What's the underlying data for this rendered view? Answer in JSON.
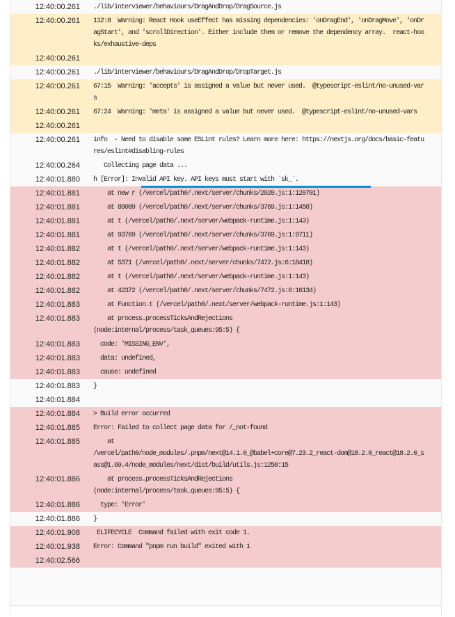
{
  "log": [
    {
      "ts": "12:40:00.261",
      "type": "normal",
      "msg": "./lib/interviewer/behaviours/DragAndDrop/DragSource.js"
    },
    {
      "ts": "12:40:00.261",
      "type": "warn",
      "msg": "112:8  Warning: React Hook useEffect has missing dependencies: 'onDragEnd', 'onDragMove', 'onDragStart', and 'scrollDirection'. Either include them or remove the dependency array.  react-hooks/exhaustive-deps"
    },
    {
      "ts": "12:40:00.261",
      "type": "warn",
      "msg": ""
    },
    {
      "ts": "12:40:00.261",
      "type": "normal",
      "msg": "./lib/interviewer/behaviours/DragAndDrop/DropTarget.js"
    },
    {
      "ts": "12:40:00.261",
      "type": "warn",
      "msg": "67:15  Warning: 'accepts' is assigned a value but never used.  @typescript-eslint/no-unused-vars"
    },
    {
      "ts": "12:40:00.261",
      "type": "warn",
      "msg": "67:24  Warning: 'meta' is assigned a value but never used.  @typescript-eslint/no-unused-vars"
    },
    {
      "ts": "12:40:00.261",
      "type": "warn",
      "msg": ""
    },
    {
      "ts": "12:40:00.261",
      "type": "normal",
      "msg": "info  - Need to disable some ESLint rules? Learn more here: https://nextjs.org/docs/basic-features/eslint#disabling-rules"
    },
    {
      "ts": "12:40:00.264",
      "type": "normal",
      "msg": "   Collecting page data ..."
    },
    {
      "ts": "12:40:01.880",
      "type": "normal",
      "msg": "h [Error]: Invalid API key. API keys must start with `sk_`.",
      "highlight": true
    },
    {
      "ts": "12:40:01.881",
      "type": "error",
      "msg": "    at new r (/vercel/path0/.next/server/chunks/2920.js:1:120701)"
    },
    {
      "ts": "12:40:01.881",
      "type": "error",
      "msg": "    at 89089 (/vercel/path0/.next/server/chunks/3769.js:1:1458)"
    },
    {
      "ts": "12:40:01.881",
      "type": "error",
      "msg": "    at t (/vercel/path0/.next/server/webpack-runtime.js:1:143)"
    },
    {
      "ts": "12:40:01.881",
      "type": "error",
      "msg": "    at 93769 (/vercel/path0/.next/server/chunks/3769.js:1:9711)"
    },
    {
      "ts": "12:40:01.882",
      "type": "error",
      "msg": "    at t (/vercel/path0/.next/server/webpack-runtime.js:1:143)"
    },
    {
      "ts": "12:40:01.882",
      "type": "error",
      "msg": "    at 5371 (/vercel/path0/.next/server/chunks/7472.js:6:18418)"
    },
    {
      "ts": "12:40:01.882",
      "type": "error",
      "msg": "    at t (/vercel/path0/.next/server/webpack-runtime.js:1:143)"
    },
    {
      "ts": "12:40:01.882",
      "type": "error",
      "msg": "    at 42372 (/vercel/path0/.next/server/chunks/7472.js:6:16134)"
    },
    {
      "ts": "12:40:01.883",
      "type": "error",
      "msg": "    at Function.t (/vercel/path0/.next/server/webpack-runtime.js:1:143)"
    },
    {
      "ts": "12:40:01.883",
      "type": "error",
      "msg": "    at process.processTicksAndRejections\n(node:internal/process/task_queues:95:5) {"
    },
    {
      "ts": "12:40:01.883",
      "type": "error",
      "msg": "  code: 'MISSING_ENV',"
    },
    {
      "ts": "12:40:01.883",
      "type": "error",
      "msg": "  data: undefined,"
    },
    {
      "ts": "12:40:01.883",
      "type": "error",
      "msg": "  cause: undefined"
    },
    {
      "ts": "12:40:01.883",
      "type": "normal",
      "msg": "}"
    },
    {
      "ts": "12:40:01.884",
      "type": "normal",
      "msg": ""
    },
    {
      "ts": "12:40:01.884",
      "type": "error",
      "msg": "> Build error occurred"
    },
    {
      "ts": "12:40:01.885",
      "type": "error",
      "msg": "Error: Failed to collect page data for /_not-found"
    },
    {
      "ts": "12:40:01.885",
      "type": "error",
      "msg": "    at\n/vercel/path0/node_modules/.pnpm/next@14.1.0_@babel+core@7.23.2_react-dom@18.2.0_react@18.2.0_sass@1.69.4/node_modules/next/dist/build/utils.js:1258:15"
    },
    {
      "ts": "12:40:01.886",
      "type": "error",
      "msg": "    at process.processTicksAndRejections\n(node:internal/process/task_queues:95:5) {"
    },
    {
      "ts": "12:40:01.886",
      "type": "error",
      "msg": "  type: 'Error'"
    },
    {
      "ts": "12:40:01.886",
      "type": "normal",
      "msg": "}"
    },
    {
      "ts": "12:40:01.908",
      "type": "error",
      "msg": " ELIFECYCLE  Command failed with exit code 1."
    },
    {
      "ts": "12:40:01.938",
      "type": "error",
      "msg": "Error: Command \"pnpm run build\" exited with 1"
    },
    {
      "ts": "12:40:02.566",
      "type": "error",
      "msg": ""
    }
  ],
  "colors": {
    "warn": "#feefc8",
    "error": "#f5cccd",
    "normal": "#fafafa",
    "highlight": "#0a8fdf"
  }
}
